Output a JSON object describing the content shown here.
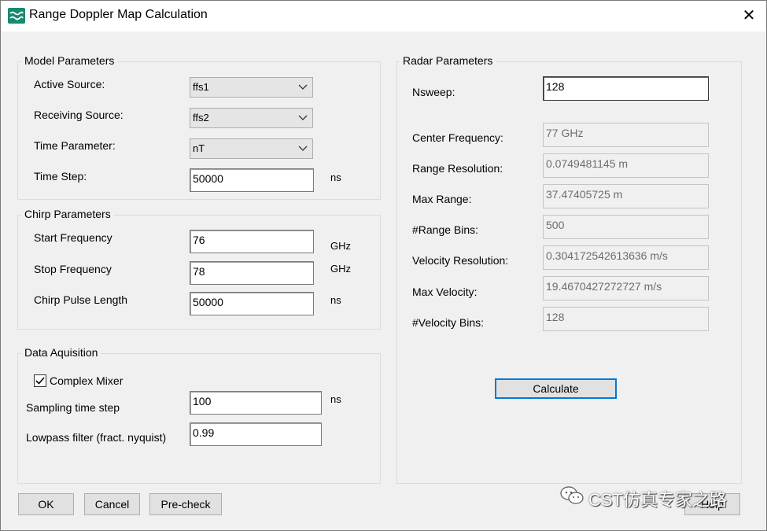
{
  "window": {
    "title": "Range Doppler Map Calculation",
    "close_glyph": "✕"
  },
  "model": {
    "title": "Model Parameters",
    "active_source_label": "Active Source:",
    "active_source_value": "ffs1",
    "receiving_source_label": "Receiving Source:",
    "receiving_source_value": "ffs2",
    "time_parameter_label": "Time Parameter:",
    "time_parameter_value": "nT",
    "time_step_label": "Time Step:",
    "time_step_value": "50000",
    "time_step_unit": "ns"
  },
  "chirp": {
    "title": "Chirp Parameters",
    "start_label": "Start Frequency",
    "start_value": "76",
    "start_unit": "GHz",
    "stop_label": "Stop Frequency",
    "stop_value": "78",
    "stop_unit": "GHz",
    "pulse_label": "Chirp Pulse Length",
    "pulse_value": "50000",
    "pulse_unit": "ns"
  },
  "acq": {
    "title": "Data Aquisition",
    "complex_mixer_label": "Complex Mixer",
    "complex_mixer_checked": true,
    "sampling_label": "Sampling time step",
    "sampling_value": "100",
    "sampling_unit": "ns",
    "lowpass_label": "Lowpass filter (fract. nyquist)",
    "lowpass_value": "0.99"
  },
  "radar": {
    "title": "Radar Parameters",
    "nsweep_label": "Nsweep:",
    "nsweep_value": "128",
    "center_freq_label": "Center Frequency:",
    "center_freq_value": "77 GHz",
    "range_res_label": "Range Resolution:",
    "range_res_value": "0.0749481145 m",
    "max_range_label": "Max Range:",
    "max_range_value": "37.47405725 m",
    "range_bins_label": "#Range Bins:",
    "range_bins_value": "500",
    "vel_res_label": "Velocity Resolution:",
    "vel_res_value": "0.304172542613636 m/s",
    "max_vel_label": "Max Velocity:",
    "max_vel_value": "19.4670427272727 m/s",
    "vel_bins_label": "#Velocity Bins:",
    "vel_bins_value": "128",
    "calculate_label": "Calculate"
  },
  "footer": {
    "ok_label": "OK",
    "cancel_label": "Cancel",
    "precheck_label": "Pre-check",
    "help_label": "Help"
  },
  "watermark": {
    "text": "CST仿真专家之路",
    "icon": "wechat-icon"
  },
  "colors": {
    "focus_blue": "#0078d7",
    "app_icon": "#1a8a6e",
    "dialog_bg": "#f0f0f0"
  }
}
